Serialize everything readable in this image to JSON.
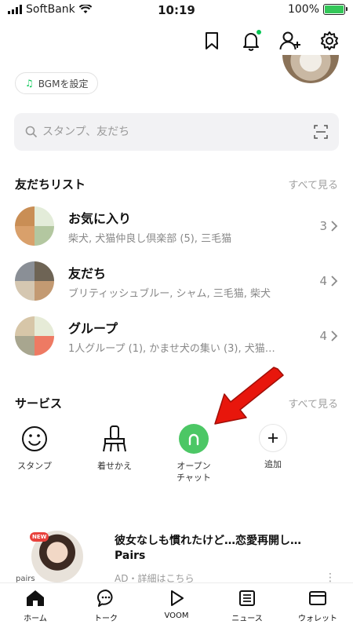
{
  "status_bar": {
    "carrier": "SoftBank",
    "time": "10:19",
    "battery": "100%"
  },
  "header": {
    "icons": [
      "bookmark-icon",
      "bell-icon",
      "add-friend-icon",
      "gear-icon"
    ]
  },
  "bgm": {
    "label": "BGMを設定"
  },
  "search": {
    "placeholder": "スタンプ、友だち"
  },
  "friends_section": {
    "title": "友だちリスト",
    "see_all": "すべて見る",
    "rows": [
      {
        "title": "お気に入り",
        "sub": "柴犬, 犬猫仲良し倶楽部 (5), 三毛猫",
        "count": "3"
      },
      {
        "title": "友だち",
        "sub": "ブリティッシュブルー, シャム, 三毛猫, 柴犬",
        "count": "4"
      },
      {
        "title": "グループ",
        "sub": "1人グループ (1), かませ犬の集い (3), 犬猫…",
        "count": "4"
      }
    ]
  },
  "services_section": {
    "title": "サービス",
    "see_all": "すべて見る",
    "items": [
      {
        "label": "スタンプ",
        "icon": "smile-icon"
      },
      {
        "label": "着せかえ",
        "icon": "brush-icon"
      },
      {
        "label1": "オープン",
        "label2": "チャット",
        "icon": "open-chat-icon"
      },
      {
        "label": "追加",
        "icon": "plus-icon"
      }
    ]
  },
  "ad": {
    "badge": "NEW",
    "brand": "pairs",
    "title": "彼女なしも慣れたけど…恋愛再開し…",
    "sponsor": "Pairs",
    "meta": "AD・詳細はこちら"
  },
  "tabs": [
    {
      "label": "ホーム",
      "icon": "home-icon",
      "active": true
    },
    {
      "label": "トーク",
      "icon": "chat-icon"
    },
    {
      "label": "VOOM",
      "icon": "voom-icon"
    },
    {
      "label": "ニュース",
      "icon": "news-icon"
    },
    {
      "label": "ウォレット",
      "icon": "wallet-icon"
    }
  ],
  "colors": {
    "accent": "#06c755",
    "open_chat": "#4cc765",
    "arrow": "#e8160c"
  }
}
